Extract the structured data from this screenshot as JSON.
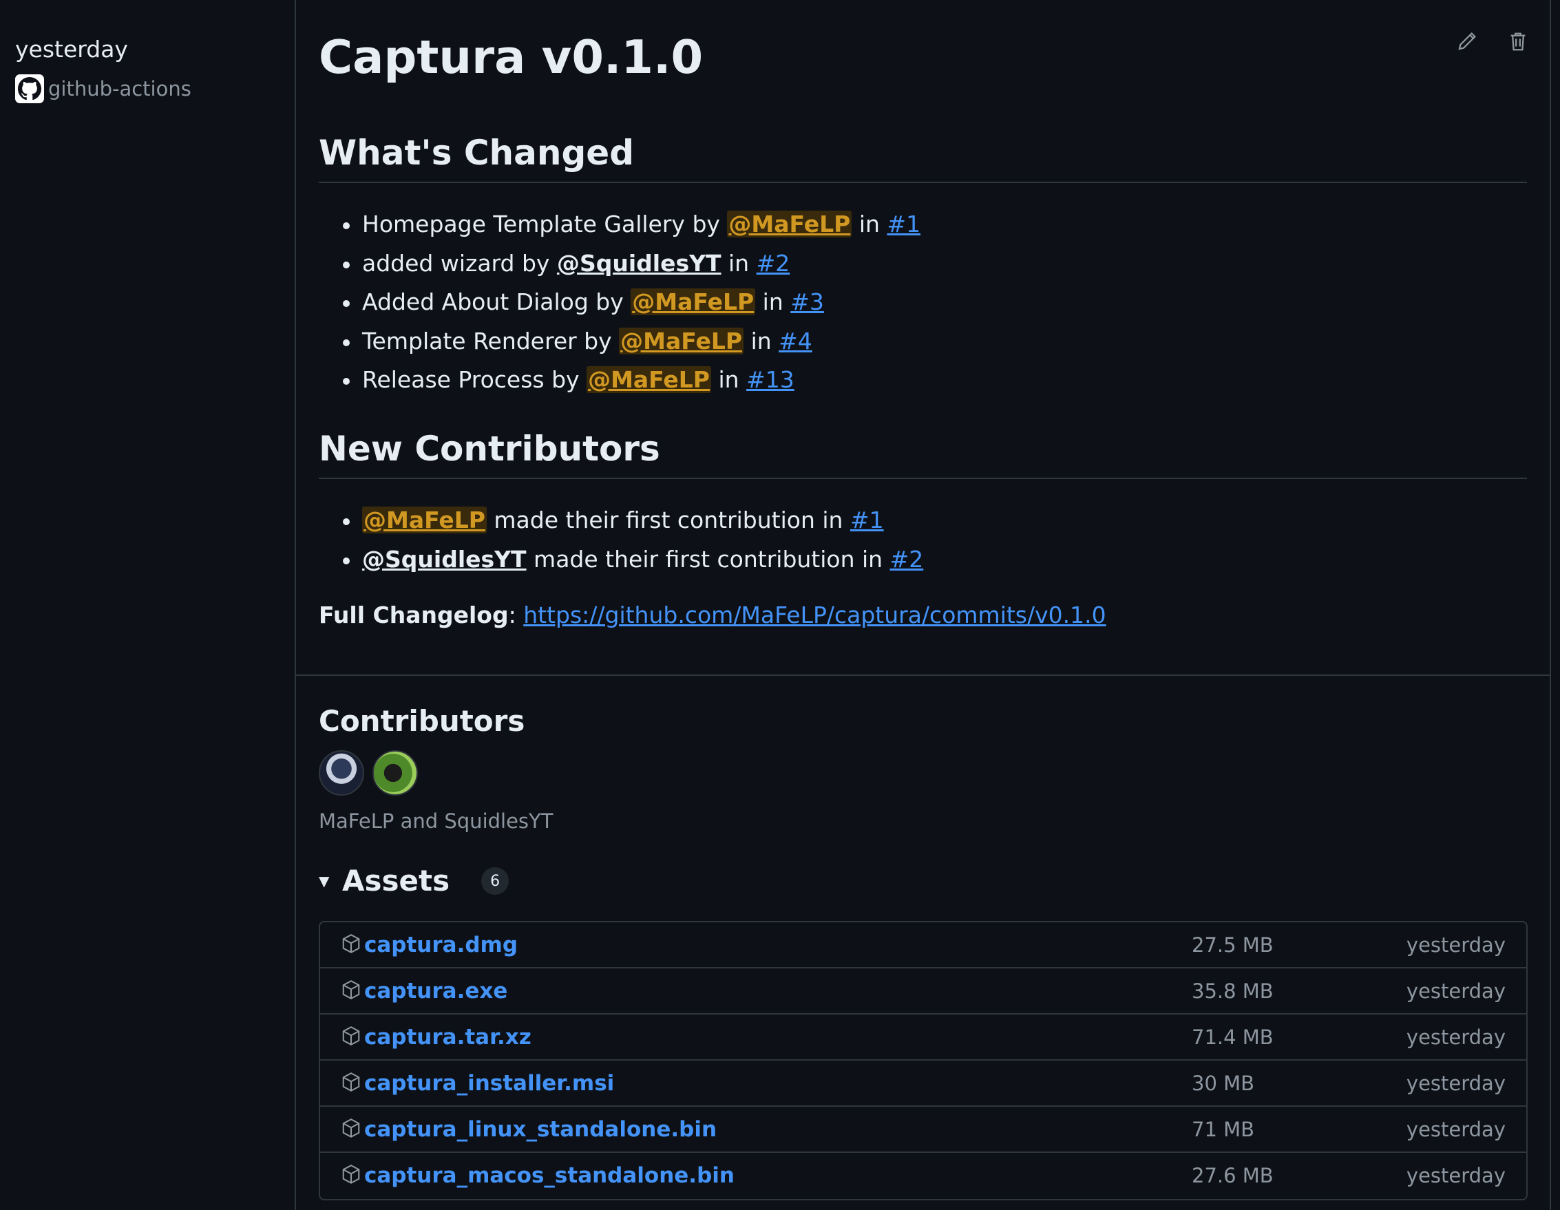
{
  "sidebar": {
    "date": "yesterday",
    "author": "github-actions"
  },
  "release": {
    "title": "Captura v0.1.0",
    "whats_changed_heading": "What's Changed",
    "changes": [
      {
        "text": "Homepage Template Gallery by ",
        "mention": "@MaFeLP",
        "in": " in ",
        "issue": "#1"
      },
      {
        "text": "added wizard by ",
        "mention": "@SquidlesYT",
        "in": " in ",
        "issue": "#2"
      },
      {
        "text": "Added About Dialog by ",
        "mention": "@MaFeLP",
        "in": " in ",
        "issue": "#3"
      },
      {
        "text": "Template Renderer by ",
        "mention": "@MaFeLP",
        "in": " in ",
        "issue": "#4"
      },
      {
        "text": "Release Process by ",
        "mention": "@MaFeLP",
        "in": " in ",
        "issue": "#13"
      }
    ],
    "new_contributors_heading": "New Contributors",
    "new_contributors": [
      {
        "mention": "@MaFeLP",
        "text": " made their first contribution in ",
        "issue": "#1"
      },
      {
        "mention": "@SquidlesYT",
        "text": " made their first contribution in ",
        "issue": "#2"
      }
    ],
    "changelog_label": "Full Changelog",
    "changelog_sep": ": ",
    "changelog_url": "https://github.com/MaFeLP/captura/commits/v0.1.0"
  },
  "contributors": {
    "heading": "Contributors",
    "names": "MaFeLP and SquidlesYT"
  },
  "assets": {
    "heading": "Assets",
    "count": "6",
    "caret": "▼",
    "items": [
      {
        "name": "captura.dmg",
        "size": "27.5 MB",
        "date": "yesterday"
      },
      {
        "name": "captura.exe",
        "size": "35.8 MB",
        "date": "yesterday"
      },
      {
        "name": "captura.tar.xz",
        "size": "71.4 MB",
        "date": "yesterday"
      },
      {
        "name": "captura_installer.msi",
        "size": "30 MB",
        "date": "yesterday"
      },
      {
        "name": "captura_linux_standalone.bin",
        "size": "71 MB",
        "date": "yesterday"
      },
      {
        "name": "captura_macos_standalone.bin",
        "size": "27.6 MB",
        "date": "yesterday"
      }
    ]
  },
  "icons": {
    "edit": "pencil-icon",
    "delete": "trash-icon",
    "asset": "package-icon",
    "author": "github-mark-icon"
  },
  "colors": {
    "background": "#0d1117",
    "link": "#4493f8",
    "mention_highlight": "#d29922",
    "muted": "#8d96a0",
    "border": "#30363d"
  }
}
